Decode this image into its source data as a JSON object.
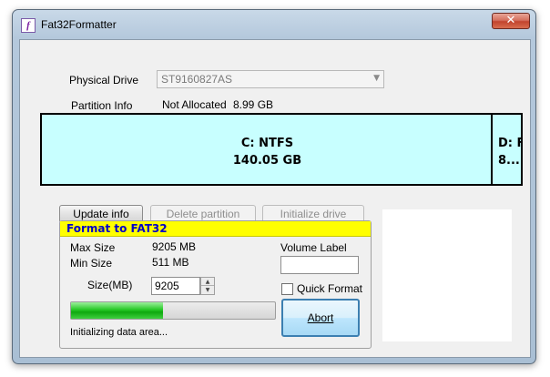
{
  "window": {
    "title": "Fat32Formatter",
    "app_icon": "app-logo-icon",
    "close_glyph": "✕"
  },
  "drive": {
    "physical_drive_label": "Physical Drive",
    "physical_drive_value": "ST9160827AS",
    "dropdown_arrow": "▼",
    "partition_info_label": "Partition Info",
    "partition_info_status": "Not Allocated",
    "partition_info_size": "8.99 GB"
  },
  "partitions": [
    {
      "line1": "C: NTFS",
      "line2": "140.05 GB"
    },
    {
      "line1": "D: F",
      "line2": "8...."
    }
  ],
  "buttons": {
    "update_info": "Update info",
    "delete_partition": "Delete partition",
    "initialize_drive": "Initialize drive",
    "abort": "Abort"
  },
  "format_group": {
    "title": "Format to FAT32",
    "max_size_label": "Max Size",
    "max_size_value": "9205 MB",
    "min_size_label": "Min Size",
    "min_size_value": "511 MB",
    "size_label": "Size(MB)",
    "size_value": "9205",
    "volume_label_label": "Volume Label",
    "volume_label_value": "",
    "quick_format_label": "Quick Format",
    "quick_format_checked": false,
    "progress_fraction": 0.45,
    "status_text": "Initializing data area..."
  },
  "colors": {
    "partition_bg": "#c8ffff",
    "group_header_bg": "#ffff00",
    "group_header_text": "#0000c8",
    "progress_green": "#10a810"
  }
}
